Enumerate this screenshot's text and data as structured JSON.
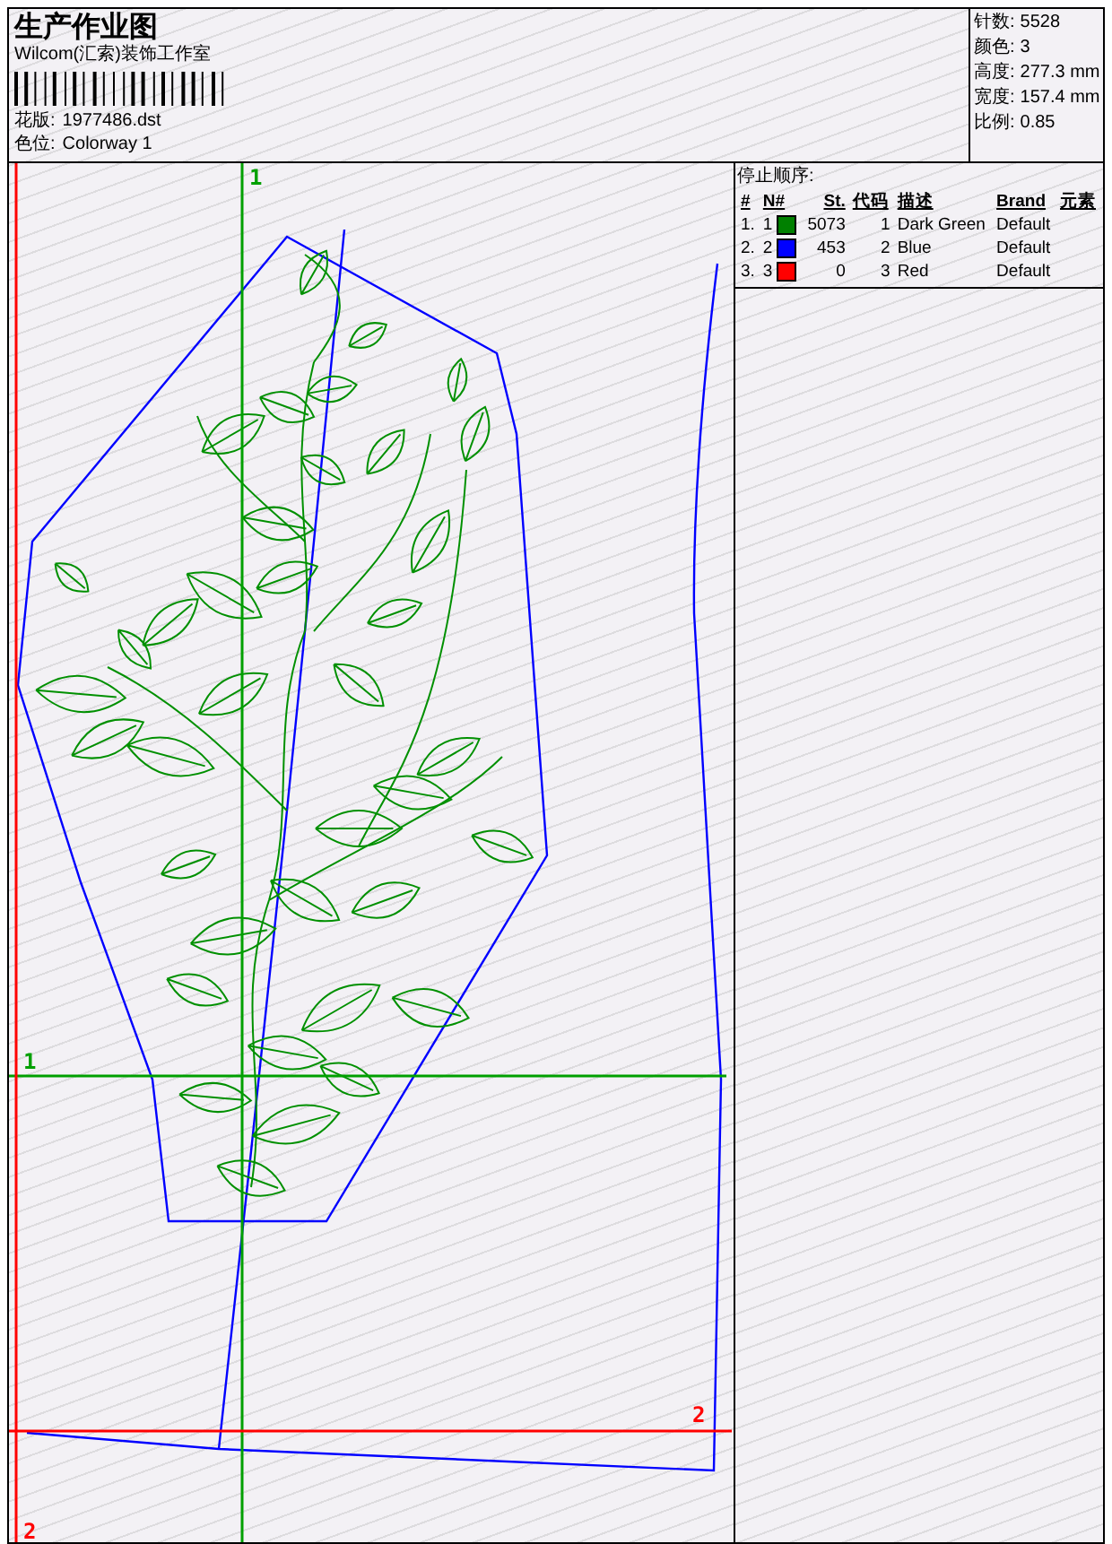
{
  "header": {
    "title": "生产作业图",
    "company": "Wilcom(汇索)装饰工作室",
    "design_label": "花版:",
    "design_value": "1977486.dst",
    "colorway_label": "色位:",
    "colorway_value": "Colorway 1"
  },
  "stats": [
    {
      "label": "针数:",
      "value": "5528"
    },
    {
      "label": "颜色:",
      "value": "3"
    },
    {
      "label": "高度:",
      "value": "277.3 mm"
    },
    {
      "label": "宽度:",
      "value": "157.4 mm"
    },
    {
      "label": "比例:",
      "value": "0.85"
    }
  ],
  "stop_sequence": {
    "title": "停止顺序:",
    "columns": [
      "#",
      "N#",
      "St.",
      "代码",
      "描述",
      "Brand",
      "元素"
    ],
    "rows": [
      {
        "index": "1.",
        "needle": "1",
        "color": "#008000",
        "stitches": "5073",
        "code": "1",
        "description": "Dark Green",
        "brand": "Default"
      },
      {
        "index": "2.",
        "needle": "2",
        "color": "#0000ff",
        "stitches": "453",
        "code": "2",
        "description": "Blue",
        "brand": "Default"
      },
      {
        "index": "3.",
        "needle": "3",
        "color": "#ff0000",
        "stitches": "0",
        "code": "3",
        "description": "Red",
        "brand": "Default"
      }
    ]
  },
  "guides": [
    {
      "kind": "vertical",
      "label": "1",
      "color": "#00a000"
    },
    {
      "kind": "horizontal",
      "label": "1",
      "color": "#00a000"
    },
    {
      "kind": "vertical",
      "label": "2",
      "color": "#ff0000"
    },
    {
      "kind": "horizontal",
      "label": "2",
      "color": "#ff0000"
    }
  ]
}
